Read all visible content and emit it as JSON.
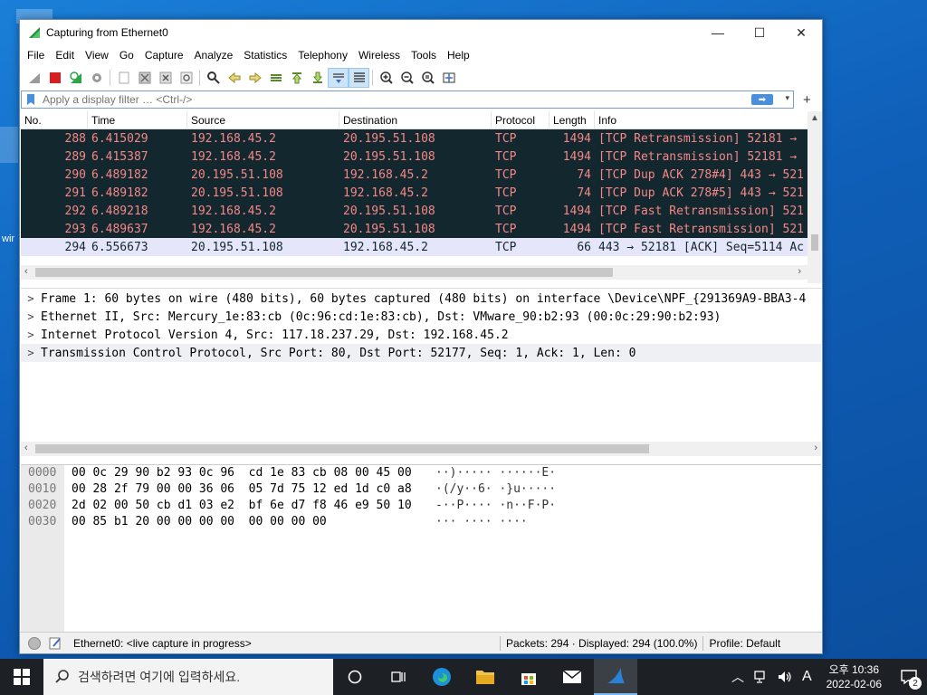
{
  "window": {
    "title": "Capturing from Ethernet0",
    "controls": {
      "minimize": "—",
      "maximize": "☐",
      "close": "✕"
    }
  },
  "menu": [
    "File",
    "Edit",
    "View",
    "Go",
    "Capture",
    "Analyze",
    "Statistics",
    "Telephony",
    "Wireless",
    "Tools",
    "Help"
  ],
  "filter": {
    "placeholder": "Apply a display filter … <Ctrl-/>",
    "apply_label": "➡",
    "dropdown": "▾",
    "add": "+"
  },
  "packet_list": {
    "columns": [
      "No.",
      "Time",
      "Source",
      "Destination",
      "Protocol",
      "Length",
      "Info"
    ],
    "rows": [
      {
        "no": "288",
        "time": "6.415029",
        "src": "192.168.45.2",
        "dst": "20.195.51.108",
        "proto": "TCP",
        "len": "1494",
        "info": "[TCP Retransmission] 52181 →",
        "style": "dark"
      },
      {
        "no": "289",
        "time": "6.415387",
        "src": "192.168.45.2",
        "dst": "20.195.51.108",
        "proto": "TCP",
        "len": "1494",
        "info": "[TCP Retransmission] 52181 →",
        "style": "dark"
      },
      {
        "no": "290",
        "time": "6.489182",
        "src": "20.195.51.108",
        "dst": "192.168.45.2",
        "proto": "TCP",
        "len": "74",
        "info": "[TCP Dup ACK 278#4] 443 → 521",
        "style": "dark"
      },
      {
        "no": "291",
        "time": "6.489182",
        "src": "20.195.51.108",
        "dst": "192.168.45.2",
        "proto": "TCP",
        "len": "74",
        "info": "[TCP Dup ACK 278#5] 443 → 521",
        "style": "dark"
      },
      {
        "no": "292",
        "time": "6.489218",
        "src": "192.168.45.2",
        "dst": "20.195.51.108",
        "proto": "TCP",
        "len": "1494",
        "info": "[TCP Fast Retransmission] 521",
        "style": "dark"
      },
      {
        "no": "293",
        "time": "6.489637",
        "src": "192.168.45.2",
        "dst": "20.195.51.108",
        "proto": "TCP",
        "len": "1494",
        "info": "[TCP Fast Retransmission] 521",
        "style": "dark"
      },
      {
        "no": "294",
        "time": "6.556673",
        "src": "20.195.51.108",
        "dst": "192.168.45.2",
        "proto": "TCP",
        "len": "66",
        "info": "443 → 52181 [ACK] Seq=5114 Ac",
        "style": "sel"
      }
    ]
  },
  "details": [
    "Frame 1: 60 bytes on wire (480 bits), 60 bytes captured (480 bits) on interface \\Device\\NPF_{291369A9-BBA3-4",
    "Ethernet II, Src: Mercury_1e:83:cb (0c:96:cd:1e:83:cb), Dst: VMware_90:b2:93 (00:0c:29:90:b2:93)",
    "Internet Protocol Version 4, Src: 117.18.237.29, Dst: 192.168.45.2",
    "Transmission Control Protocol, Src Port: 80, Dst Port: 52177, Seq: 1, Ack: 1, Len: 0"
  ],
  "bytes": [
    {
      "offset": "0000",
      "hex": "00 0c 29 90 b2 93 0c 96  cd 1e 83 cb 08 00 45 00",
      "ascii": "··)····· ······E·"
    },
    {
      "offset": "0010",
      "hex": "00 28 2f 79 00 00 36 06  05 7d 75 12 ed 1d c0 a8",
      "ascii": "·(/y··6· ·}u·····"
    },
    {
      "offset": "0020",
      "hex": "2d 02 00 50 cb d1 03 e2  bf 6e d7 f8 46 e9 50 10",
      "ascii": "-··P···· ·n··F·P·"
    },
    {
      "offset": "0030",
      "hex": "00 85 b1 20 00 00 00 00  00 00 00 00",
      "ascii": "··· ···· ····"
    }
  ],
  "status": {
    "interface": "Ethernet0: <live capture in progress>",
    "packets": "Packets: 294 · Displayed: 294 (100.0%)",
    "profile": "Profile: Default"
  },
  "taskbar": {
    "search_placeholder": "검색하려면 여기에 입력하세요.",
    "time": "오후 10:36",
    "date": "2022-02-06",
    "ime": "A",
    "notifications": "2"
  },
  "colors": {
    "dark_row_bg": "#12272e",
    "dark_row_fg": "#f78787",
    "selected_row_bg": "#e6e6fa",
    "accent": "#4a8fdb"
  }
}
